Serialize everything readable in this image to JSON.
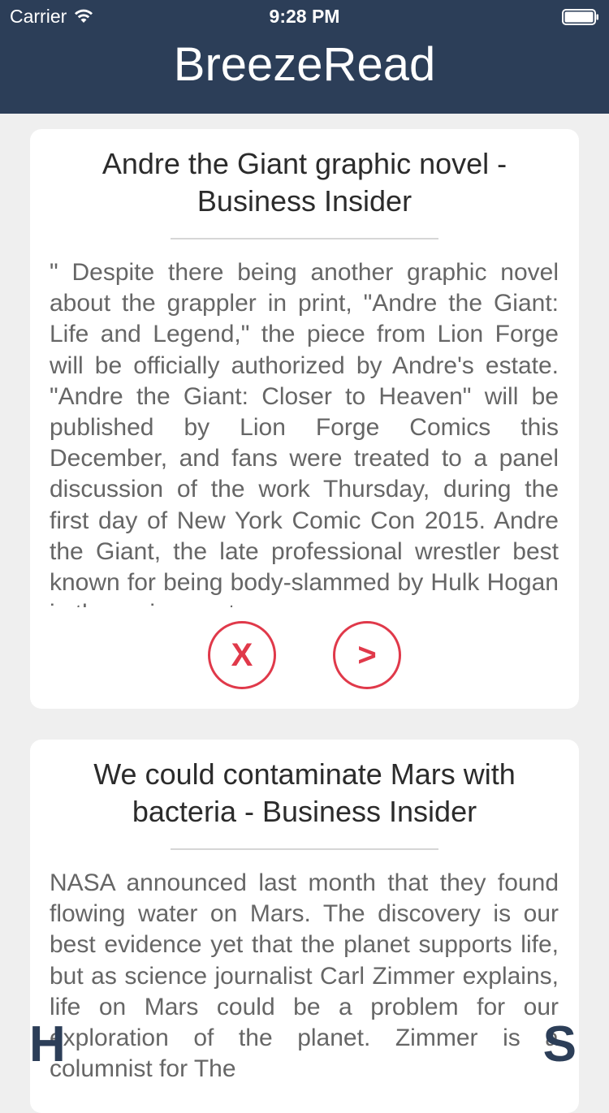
{
  "status_bar": {
    "carrier": "Carrier",
    "time": "9:28 PM",
    "icons": [
      "wifi-icon",
      "battery-icon"
    ]
  },
  "header": {
    "title": "BreezeRead",
    "background_color": "#2c3e58"
  },
  "articles": [
    {
      "title": "Andre the Giant graphic novel - Business Insider",
      "body": "\" Despite there being another graphic novel about the grappler in print, \"Andre the Giant: Life and Legend,\" the piece from Lion Forge will be officially authorized by Andre's estate.  \"Andre the Giant: Closer to Heaven\" will be published by Lion Forge Comics this December, and fans were treated to a panel discussion of the work Thursday, during the first day of New York Comic Con 2015. Andre the Giant, the late professional wrestler best known for being body-slammed by Hulk Hogan in the main event",
      "actions": {
        "dismiss_label": "X",
        "open_label": ">"
      }
    },
    {
      "title": "We could contaminate Mars with bacteria - Business Insider",
      "body": "NASA announced last month that they found flowing water on Mars.   The discovery is our best evidence yet that the planet supports life, but as science journalist Carl Zimmer explains, life on Mars could be a problem for our exploration of the planet.  Zimmer is a columnist for The"
    }
  ],
  "bottom_buttons": {
    "left_label": "H",
    "right_label": "S"
  },
  "colors": {
    "accent": "#e0394a",
    "page_background": "#efefef",
    "card_background": "#ffffff"
  }
}
